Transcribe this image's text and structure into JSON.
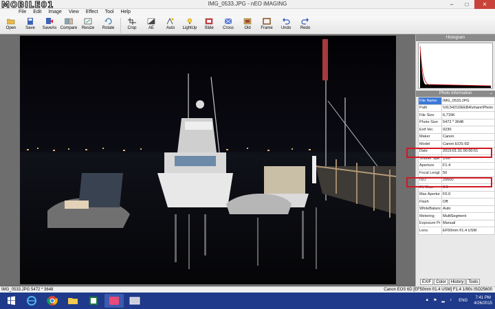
{
  "window": {
    "title": "IMG_0533.JPG - nEO iMAGING",
    "minimize": "–",
    "maximize": "□",
    "close": "✕"
  },
  "watermark": "MOBILE01",
  "menu": [
    {
      "label": "File"
    },
    {
      "label": "Edit"
    },
    {
      "label": "Image"
    },
    {
      "label": "View"
    },
    {
      "label": "Effect"
    },
    {
      "label": "Tool"
    },
    {
      "label": "Help"
    }
  ],
  "toolbar": [
    {
      "label": "Open",
      "icon": "open-icon"
    },
    {
      "label": "Save",
      "icon": "save-icon"
    },
    {
      "label": "SaveAs",
      "icon": "saveas-icon"
    },
    {
      "label": "Compare",
      "icon": "compare-icon"
    },
    {
      "label": "Resize",
      "icon": "resize-icon"
    },
    {
      "label": "Rotate",
      "icon": "rotate-icon"
    },
    {
      "label": "Crop",
      "icon": "crop-icon"
    },
    {
      "label": "AE",
      "icon": "ae-icon"
    },
    {
      "label": "Auto",
      "icon": "auto-icon"
    },
    {
      "label": "LightUp",
      "icon": "lightup-icon"
    },
    {
      "label": "Slide",
      "icon": "slide-icon"
    },
    {
      "label": "Cross",
      "icon": "cross-icon"
    },
    {
      "label": "Old",
      "icon": "old-icon"
    },
    {
      "label": "Frame",
      "icon": "frame-icon"
    },
    {
      "label": "Undo",
      "icon": "undo-icon"
    },
    {
      "label": "Redo",
      "icon": "redo-icon"
    }
  ],
  "panel": {
    "histogram_title": "Histogram",
    "info_title": "Photo Information",
    "info": [
      {
        "key": "File Name",
        "value": "IMG_0533.JPG",
        "selected": true
      },
      {
        "key": "Path",
        "value": "\\\\XL5421DEEBA\\share\\Photo"
      },
      {
        "key": "File Size",
        "value": "6,715K"
      },
      {
        "key": "Photo Size",
        "value": "5472 * 3648"
      },
      {
        "key": "Exif Ver.",
        "value": "0230"
      },
      {
        "key": "Maker",
        "value": "Canon"
      },
      {
        "key": "Model",
        "value": "Canon EOS 6D"
      },
      {
        "key": "Date",
        "value": "2015:01:31 00:00:51",
        "highlight": true
      },
      {
        "key": "Shutter Spe",
        "value": "1/90"
      },
      {
        "key": "Aperture",
        "value": "F1.4"
      },
      {
        "key": "Focal Lengt",
        "value": "50"
      },
      {
        "key": "ISO",
        "value": "25600",
        "highlight": true
      },
      {
        "key": "EV Bias",
        "value": "0.0"
      },
      {
        "key": "Max Apertur",
        "value": "F0.0"
      },
      {
        "key": "Flash",
        "value": "Off"
      },
      {
        "key": "WhiteBalanc",
        "value": "Auto"
      },
      {
        "key": "Metering",
        "value": "MultiSegment"
      },
      {
        "key": "Exposure Pr",
        "value": "Manual"
      },
      {
        "key": "Lens",
        "value": "EF50mm f/1.4 USM"
      }
    ],
    "tabs": [
      {
        "label": "EXIF",
        "active": true
      },
      {
        "label": "Color"
      },
      {
        "label": "History"
      },
      {
        "label": "Tools"
      }
    ]
  },
  "status": {
    "left": "IMG_0533.JPG   5472 * 3648",
    "right": "Canon EOS 6D [EF50mm f/1.4 USM] F1.4 1/90s ISO25600"
  },
  "taskbar": {
    "apps": [
      "start-icon",
      "ie-icon",
      "chrome-icon",
      "explorer-icon",
      "excel-icon",
      "neo-imaging-icon",
      "photo-viewer-icon"
    ],
    "lang": "ENG",
    "time": "7:41 PM",
    "date": "4/26/2015"
  }
}
